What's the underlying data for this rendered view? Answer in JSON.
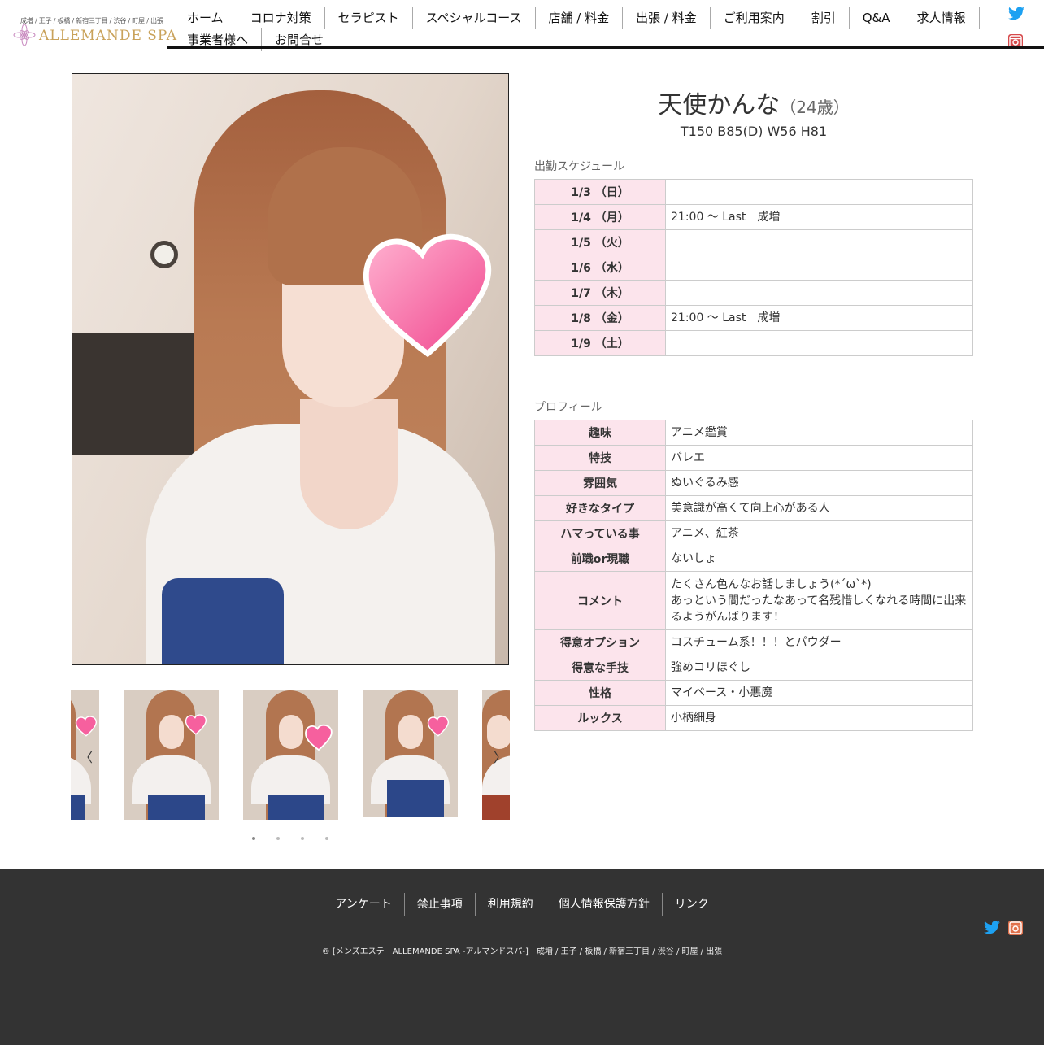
{
  "logo": {
    "areas": "成増 / 王子 / 板橋 / 新宿三丁目 / 渋谷 / 町屋 / 出張",
    "name": "ALLEMANDE SPA"
  },
  "nav": {
    "row1": [
      "ホーム",
      "コロナ対策",
      "セラピスト",
      "スペシャルコース",
      "店舗 / 料金",
      "出張 / 料金",
      "ご利用案内",
      "割引",
      "Q&A",
      "求人情報"
    ],
    "row2": [
      "事業者様へ",
      "お問合せ"
    ]
  },
  "therapist": {
    "name": "天使かんな",
    "age": "（24歳）",
    "measurements": "T150 B85(D) W56 H81"
  },
  "schedule": {
    "title": "出勤スケジュール",
    "rows": [
      {
        "date": "1/3 （日）",
        "value": ""
      },
      {
        "date": "1/4 （月）",
        "value": "21:00 ～ Last　成増"
      },
      {
        "date": "1/5 （火）",
        "value": ""
      },
      {
        "date": "1/6 （水）",
        "value": ""
      },
      {
        "date": "1/7 （木）",
        "value": ""
      },
      {
        "date": "1/8 （金）",
        "value": "21:00 ～ Last　成増"
      },
      {
        "date": "1/9 （土）",
        "value": ""
      }
    ]
  },
  "profile": {
    "title": "プロフィール",
    "rows": [
      {
        "label": "趣味",
        "value": "アニメ鑑賞"
      },
      {
        "label": "特技",
        "value": "バレエ"
      },
      {
        "label": "雰囲気",
        "value": "ぬいぐるみ感"
      },
      {
        "label": "好きなタイプ",
        "value": "美意識が高くて向上心がある人"
      },
      {
        "label": "ハマっている事",
        "value": "アニメ、紅茶"
      },
      {
        "label": "前職or現職",
        "value": "ないしょ"
      },
      {
        "label": "コメント",
        "value_line1": "たくさん色んなお話しましょう(*´ω`*)",
        "value_line2": "あっという間だったなあって名残惜しくなれる時間に出来るようがんばります！"
      },
      {
        "label": "得意オプション",
        "value": "コスチューム系！！！とパウダー"
      },
      {
        "label": "得意な手技",
        "value": "強めコリほぐし"
      },
      {
        "label": "性格",
        "value": "マイペース・小悪魔"
      },
      {
        "label": "ルックス",
        "value": "小柄細身"
      }
    ]
  },
  "footer": {
    "links": [
      "アンケート",
      "禁止事項",
      "利用規約",
      "個人情報保護方針",
      "リンク"
    ],
    "copyright": "® [メンズエステ　ALLEMANDE SPA -アルマンドスパ-]　成増 / 王子 / 板橋 / 新宿三丁目 / 渋谷 / 町屋 / 出張"
  },
  "icons": {
    "twitter": "twitter-icon",
    "instagram": "instagram-icon",
    "prev": "chevron-left-icon",
    "next": "chevron-right-icon"
  },
  "colors": {
    "accent_pink": "#fce4ec",
    "twitter_blue": "#1da1f2",
    "footer_bg": "#333333",
    "logo_gold": "#c9a25a"
  },
  "carousel": {
    "slides": 4,
    "active": 0
  }
}
